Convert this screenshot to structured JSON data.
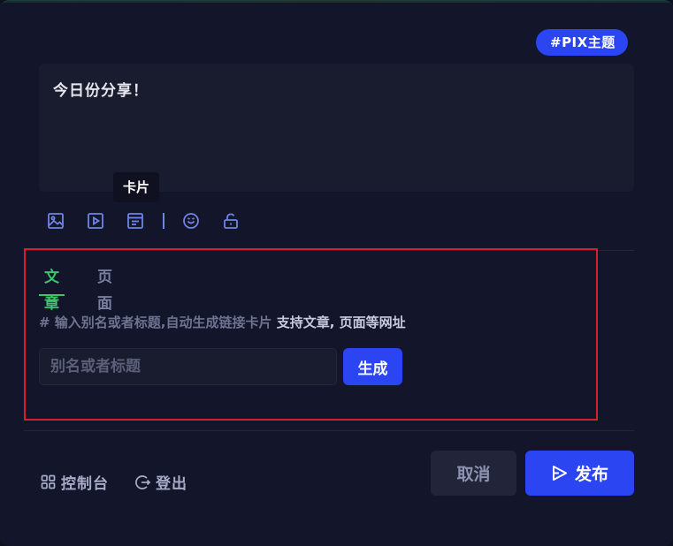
{
  "topic_tag": "#PIX主题",
  "post": {
    "text": "今日份分享！"
  },
  "tooltip": "卡片",
  "toolbar": {
    "icons": [
      "image-icon",
      "video-icon",
      "card-icon",
      "emoji-icon",
      "unlock-icon"
    ]
  },
  "card_panel": {
    "tabs": [
      {
        "label": "文章",
        "active": true
      },
      {
        "label": "页面",
        "active": false
      }
    ],
    "hint_prefix": "# 输入别名或者标题,自动生成链接卡片",
    "hint_bold": "支持文章, 页面等网址",
    "input_placeholder": "别名或者标题",
    "generate_label": "生成"
  },
  "footer": {
    "console_label": "控制台",
    "logout_label": "登出",
    "cancel_label": "取消",
    "publish_label": "发布"
  },
  "colors": {
    "accent": "#2b45f2",
    "active_tab": "#3ec46d",
    "highlight_border": "#d61f2c",
    "background": "#13152a"
  }
}
